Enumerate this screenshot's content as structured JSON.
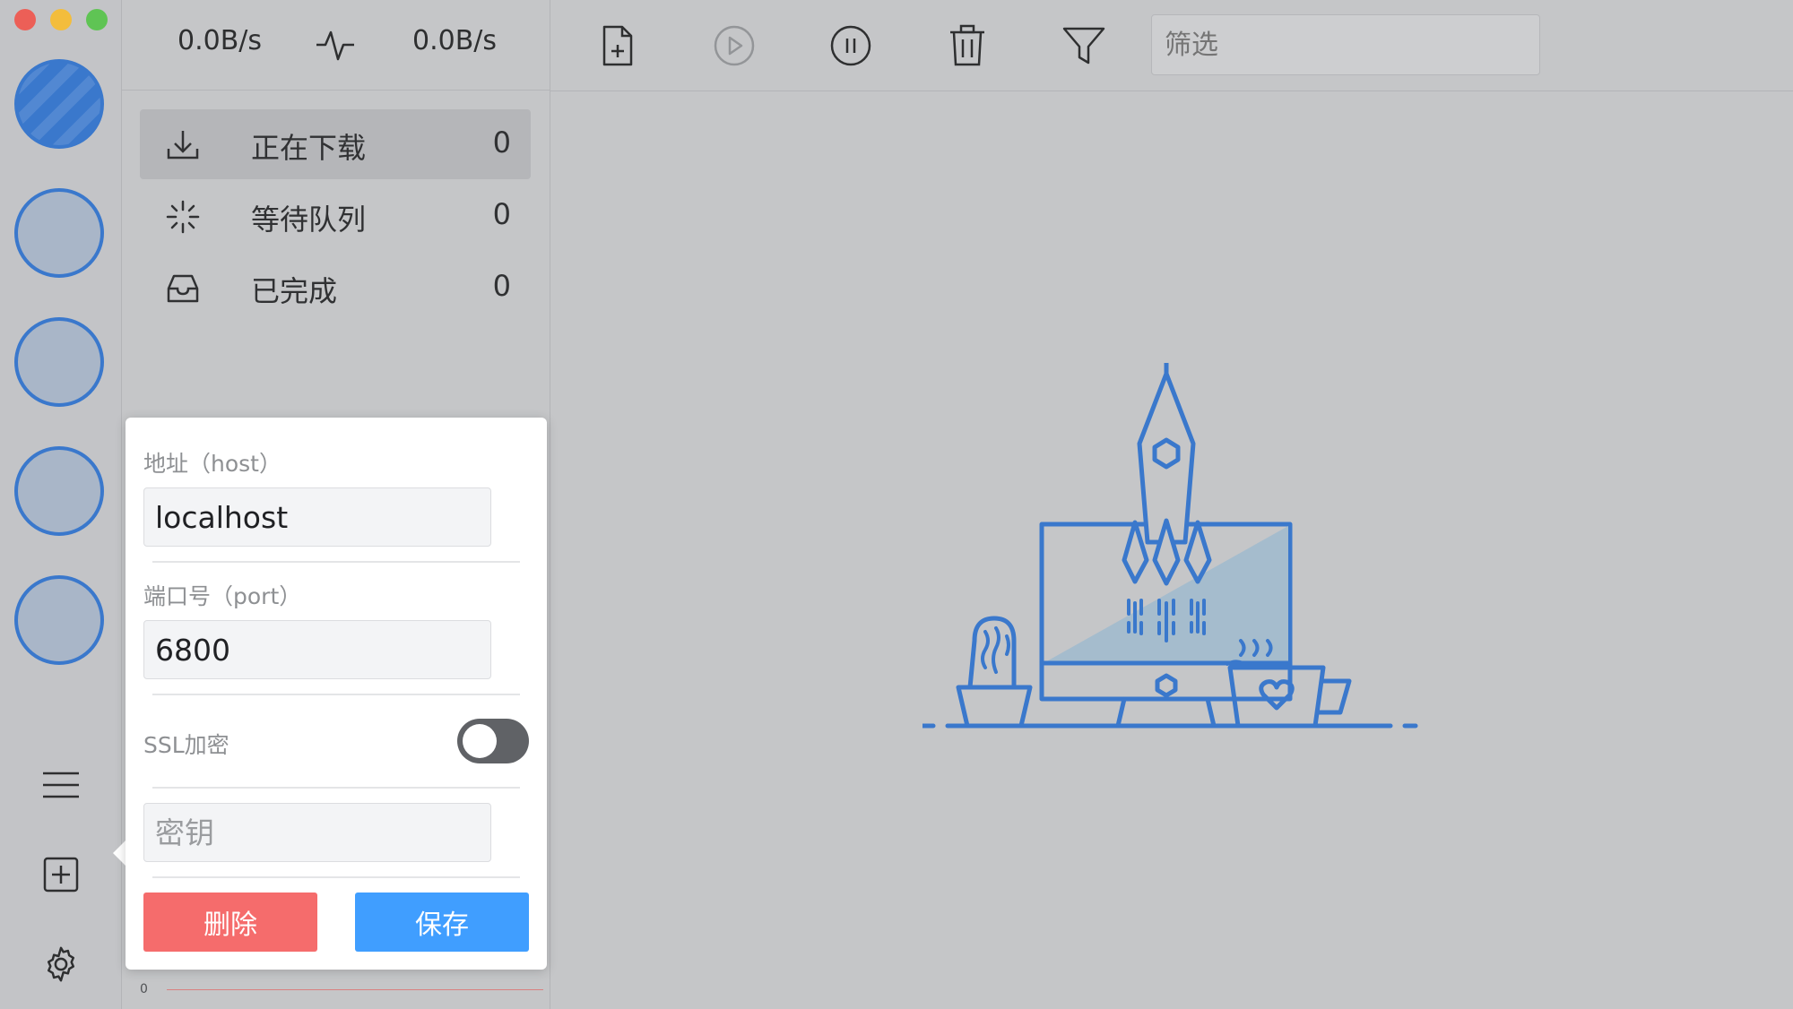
{
  "speed": {
    "upload": "0.0B/s",
    "download": "0.0B/s"
  },
  "nav": [
    {
      "label": "正在下载",
      "count": "0",
      "icon": "download-icon"
    },
    {
      "label": "等待队列",
      "count": "0",
      "icon": "loading-icon"
    },
    {
      "label": "已完成",
      "count": "0",
      "icon": "inbox-icon"
    }
  ],
  "toolbar": {
    "filter_placeholder": "筛选",
    "icons": [
      "new-task-icon",
      "play-icon",
      "pause-icon",
      "trash-icon",
      "filter-icon"
    ]
  },
  "rail": {
    "icons": [
      "menu-icon",
      "add-server-icon",
      "gear-icon"
    ]
  },
  "popover": {
    "host_label": "地址（host）",
    "host_value": "localhost",
    "port_label": "端口号（port）",
    "port_value": "6800",
    "ssl_label": "SSL加密",
    "ssl_enabled": false,
    "secret_placeholder": "密钥",
    "delete_label": "删除",
    "save_label": "保存"
  },
  "speed_chart": {
    "zero_label": "0"
  },
  "colors": {
    "accent": "#3a78cc",
    "delete": "#f56c6c",
    "save": "#409eff"
  }
}
